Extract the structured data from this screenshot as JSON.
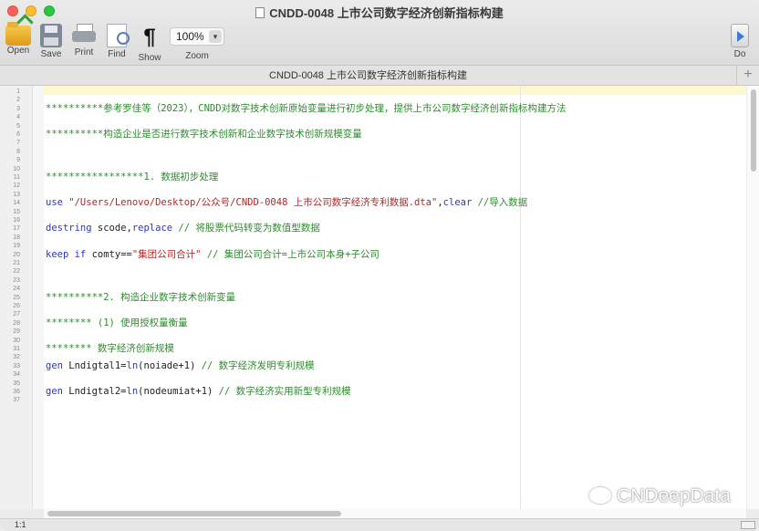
{
  "window": {
    "title": "CNDD-0048 上市公司数字经济创新指标构建"
  },
  "toolbar": {
    "open_label": "Open",
    "save_label": "Save",
    "print_label": "Print",
    "find_label": "Find",
    "show_label": "Show",
    "zoom_value": "100%",
    "zoom_label": "Zoom",
    "do_label": "Do"
  },
  "tab": {
    "label": "CNDD-0048 上市公司数字经济创新指标构建",
    "add_glyph": "+"
  },
  "editor": {
    "lines": [
      {
        "n": "1",
        "text": ""
      },
      {
        "n": "2",
        "text": ""
      },
      {
        "n": "3",
        "text": "**********参考罗佳等（2023），CNDD对数字技术创新原始变量进行初步处理，提供上市公司数字经济创新指标构建方法"
      },
      {
        "n": "4",
        "text": ""
      },
      {
        "n": "5",
        "text": ""
      },
      {
        "n": "6",
        "text": "**********构造企业是否进行数字技术创新和企业数字技术创新规模变量"
      },
      {
        "n": "7",
        "text": ""
      },
      {
        "n": "8",
        "text": ""
      },
      {
        "n": "9",
        "text": ""
      },
      {
        "n": "10",
        "text": ""
      },
      {
        "n": "11",
        "text": "*****************1. 数据初步处理"
      },
      {
        "n": "12",
        "text": ""
      },
      {
        "n": "13",
        "text": ""
      },
      {
        "n": "14",
        "k1": "use",
        "s1": " \"/Users/Lenovo/Desktop/公众号/CNDD-0048 上市公司数字经济专利数据.dta\"",
        "t1": ",",
        "k2": "clear",
        "c1": " //导入数据"
      },
      {
        "n": "15",
        "text": ""
      },
      {
        "n": "16",
        "text": ""
      },
      {
        "n": "17",
        "k1": "destring",
        "t1": " scode,",
        "k2": "replace",
        "c1": " // 将股票代码转变为数值型数据"
      },
      {
        "n": "18",
        "text": ""
      },
      {
        "n": "19",
        "text": ""
      },
      {
        "n": "20",
        "k1": "keep if",
        "t1": " comty==",
        "s1": "\"集团公司合计\"",
        "c1": " // 集团公司合计=上市公司本身+子公司"
      },
      {
        "n": "21",
        "text": ""
      },
      {
        "n": "22",
        "text": ""
      },
      {
        "n": "23",
        "text": ""
      },
      {
        "n": "24",
        "text": ""
      },
      {
        "n": "25",
        "text": "**********2. 构造企业数字技术创新变量"
      },
      {
        "n": "26",
        "text": ""
      },
      {
        "n": "27",
        "text": ""
      },
      {
        "n": "28",
        "text": "******** (1) 使用授权量衡量"
      },
      {
        "n": "29",
        "text": ""
      },
      {
        "n": "30",
        "text": ""
      },
      {
        "n": "31",
        "text": "******** 数字经济创新规模"
      },
      {
        "n": "32",
        "text": ""
      },
      {
        "n": "33",
        "k1": "gen",
        "t1": " Lndigtal1=",
        "k2": "ln",
        "t2": "(noiade+1)",
        "c1": " // 数字经济发明专利规模"
      },
      {
        "n": "34",
        "text": ""
      },
      {
        "n": "35",
        "text": ""
      },
      {
        "n": "36",
        "k1": "gen",
        "t1": " Lndigtal2=",
        "k2": "ln",
        "t2": "(nodeumiat+1)",
        "c1": " // 数字经济实用新型专利规模"
      },
      {
        "n": "37",
        "text": ""
      }
    ]
  },
  "status": {
    "position": "1:1"
  },
  "watermark": {
    "text": "CNDeepData"
  },
  "colors": {
    "comment": "#2e8b2e",
    "keyword": "#2a35c8",
    "string": "#b02828",
    "current_line": "#fdf8cf"
  }
}
